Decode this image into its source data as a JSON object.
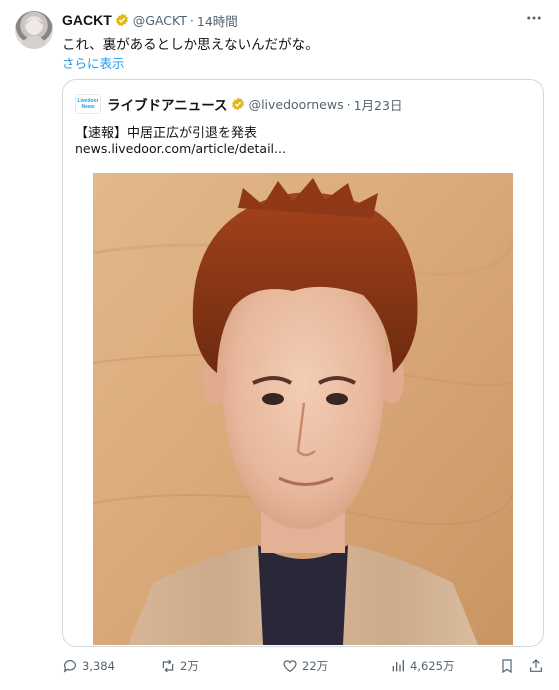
{
  "tweet": {
    "display_name": "GACKT",
    "handle": "@GACKT",
    "separator": "·",
    "time": "14時間",
    "text": "これ、裏があるとしか思えないんだがな。",
    "show_more": "さらに表示",
    "more_icon": "more-icon"
  },
  "quote": {
    "logo_line1": "Livedoor",
    "logo_line2": "News",
    "display_name": "ライブドアニュース",
    "handle": "@livedoornews",
    "separator": "·",
    "date": "1月23日",
    "text": "【速報】中居正広が引退を発表",
    "link": "news.livedoor.com/article/detail..."
  },
  "actions": {
    "replies": "3,384",
    "retweets": "2万",
    "likes": "22万",
    "views": "4,625万"
  },
  "colors": {
    "accent": "#1d9bf0",
    "verified_gold": "#e2b719",
    "text_secondary": "#536471",
    "border": "#cfd9de"
  }
}
